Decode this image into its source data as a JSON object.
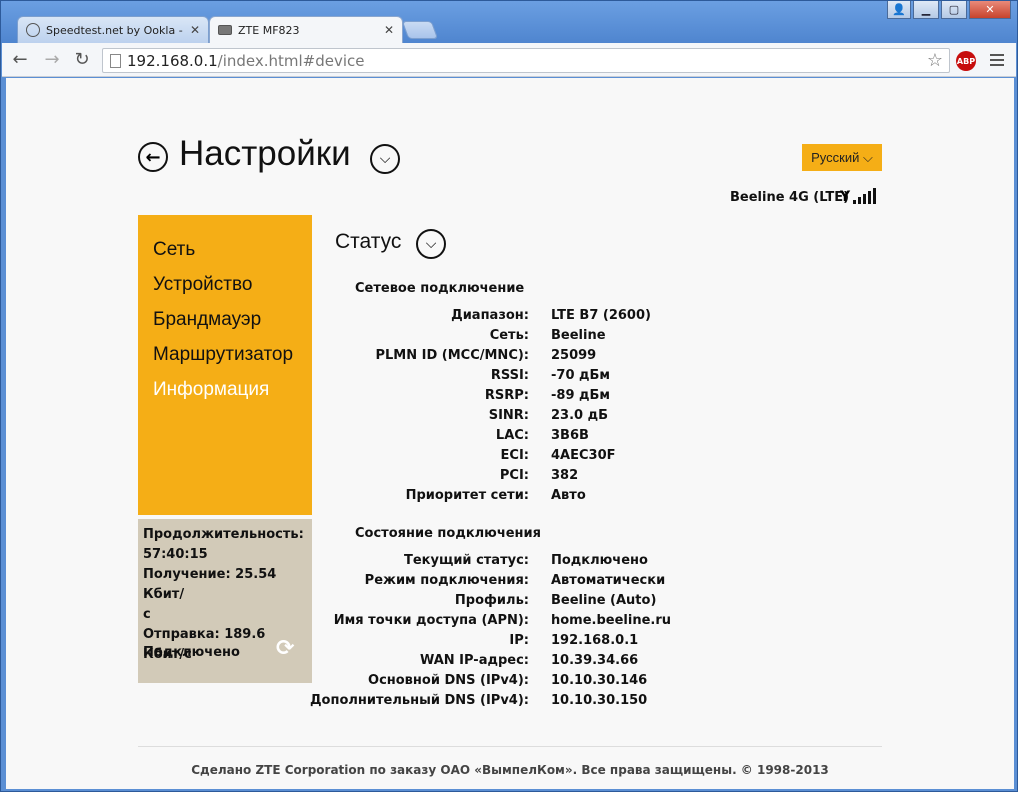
{
  "browser": {
    "tabs": [
      {
        "title": "Speedtest.net by Ookla - Гл",
        "active": false
      },
      {
        "title": "ZTE MF823",
        "active": true
      }
    ],
    "url_host": "192.168.0.1",
    "url_path": "/index.html#device",
    "abp_label": "ABP"
  },
  "header": {
    "title": "Настройки",
    "language": "Русский ⌵",
    "network": "Beeline 4G (LTE)"
  },
  "sidebar": {
    "items": [
      {
        "label": "Сеть",
        "active": false
      },
      {
        "label": "Устройство",
        "active": false
      },
      {
        "label": "Брандмауэр",
        "active": false
      },
      {
        "label": "Маршрутизатор",
        "active": false
      },
      {
        "label": "Информация",
        "active": true
      }
    ]
  },
  "stats": {
    "duration_label": "Продолжительность:",
    "duration_value": "57:40:15",
    "receive_line1": "Получение: 25.54 Кбит/",
    "receive_line2": "с",
    "send": "Отправка: 189.6 Кбит/с",
    "status": "Подключено"
  },
  "main": {
    "section_title": "Статус",
    "network_group": {
      "title": "Сетевое подключение",
      "rows": [
        {
          "key": "Диапазон:",
          "value": "LTE B7 (2600)"
        },
        {
          "key": "Сеть:",
          "value": "Beeline"
        },
        {
          "key": "PLMN ID (MCC/MNC):",
          "value": "25099"
        },
        {
          "key": "RSSI:",
          "value": "-70 дБм"
        },
        {
          "key": "RSRP:",
          "value": "-89 дБм"
        },
        {
          "key": "SINR:",
          "value": "23.0 дБ"
        },
        {
          "key": "LAC:",
          "value": "3B6B"
        },
        {
          "key": "ECI:",
          "value": "4AEC30F"
        },
        {
          "key": "PCI:",
          "value": "382"
        },
        {
          "key": "Приоритет сети:",
          "value": "Авто"
        }
      ]
    },
    "connection_group": {
      "title": "Состояние подключения",
      "rows": [
        {
          "key": "Текущий статус:",
          "value": "Подключено"
        },
        {
          "key": "Режим подключения:",
          "value": "Автоматически"
        },
        {
          "key": "Профиль:",
          "value": "Beeline (Auto)"
        },
        {
          "key": "Имя точки доступа (APN):",
          "value": "home.beeline.ru"
        },
        {
          "key": "IP:",
          "value": "192.168.0.1"
        },
        {
          "key": "WAN IP-адрес:",
          "value": "10.39.34.66"
        },
        {
          "key": "Основной DNS (IPv4):",
          "value": "10.10.30.146"
        },
        {
          "key": "Дополнительный DNS (IPv4):",
          "value": "10.10.30.150"
        }
      ]
    }
  },
  "footer": "Сделано ZTE Corporation по заказу ОАО «ВымпелКом». Все права защищены. © 1998-2013",
  "colors": {
    "accent": "#f5ae16",
    "stats_bg": "#d2cab8"
  }
}
